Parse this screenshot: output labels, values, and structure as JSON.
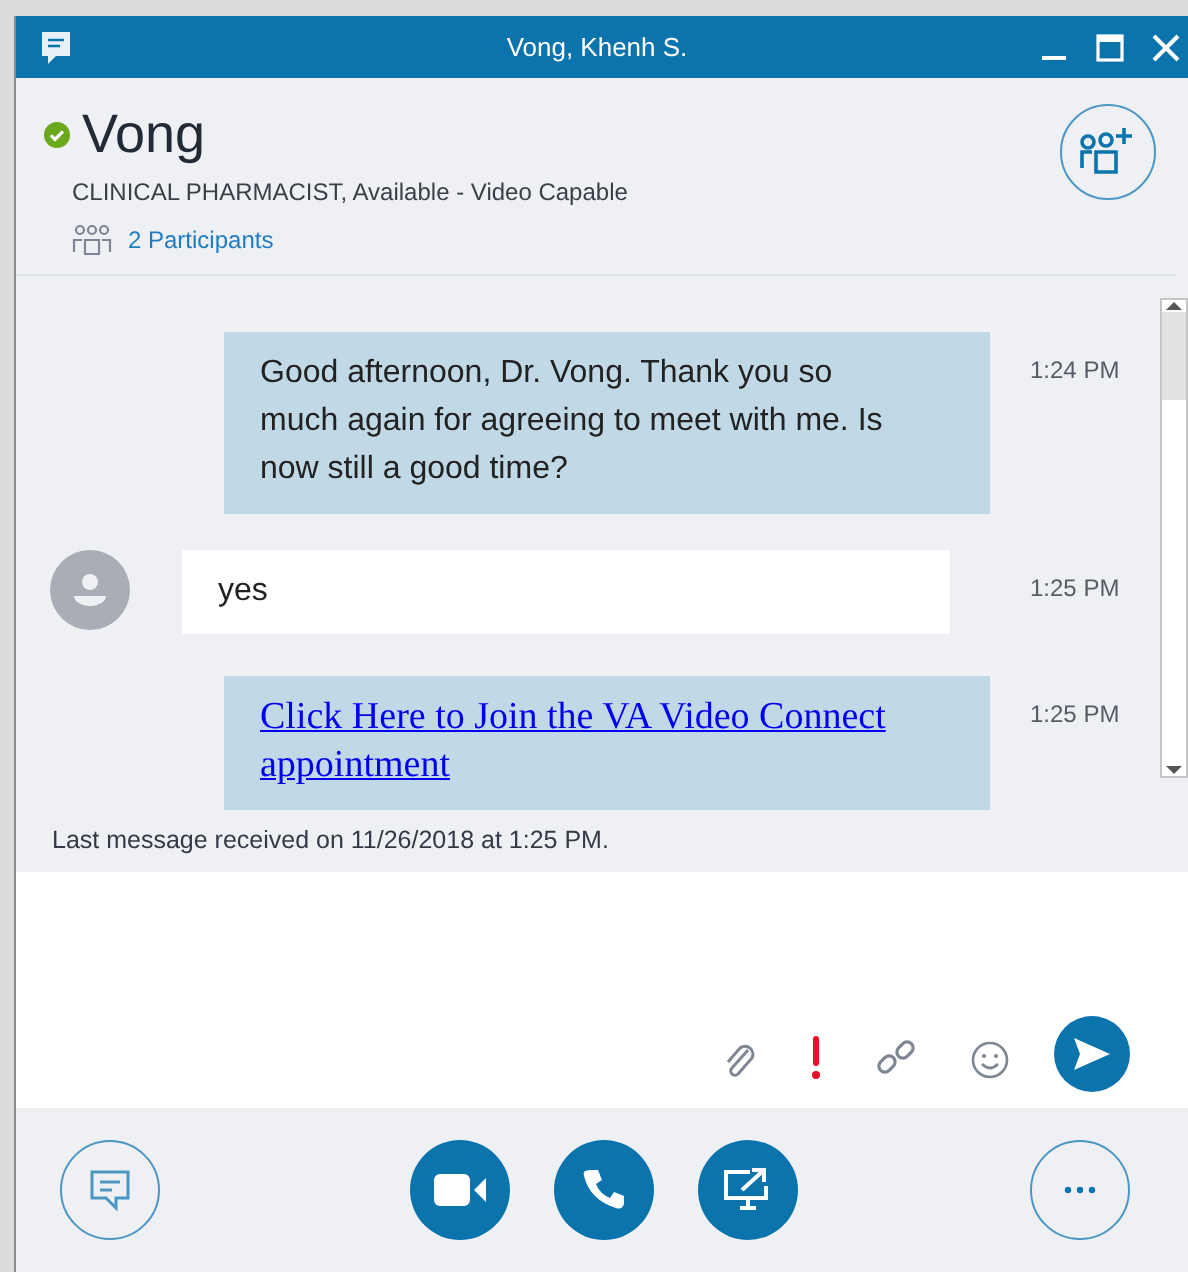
{
  "window": {
    "title": "Vong, Khenh S."
  },
  "contact": {
    "name": "Vong",
    "available": true,
    "details": "CLINICAL PHARMACIST, Available - Video Capable",
    "participants": "2 Participants"
  },
  "messages": [
    {
      "kind": "outgoing",
      "text": "Good afternoon, Dr. Vong. Thank you so much again for agreeing to meet with me. Is now still a good time?",
      "time": "1:24 PM"
    },
    {
      "kind": "incoming",
      "text": "yes",
      "time": "1:25 PM"
    },
    {
      "kind": "link",
      "text": "Click Here to Join the VA Video Connect appointment",
      "time": "1:25 PM"
    }
  ],
  "last_message": "Last message received on 11/26/2018 at 1:25 PM."
}
